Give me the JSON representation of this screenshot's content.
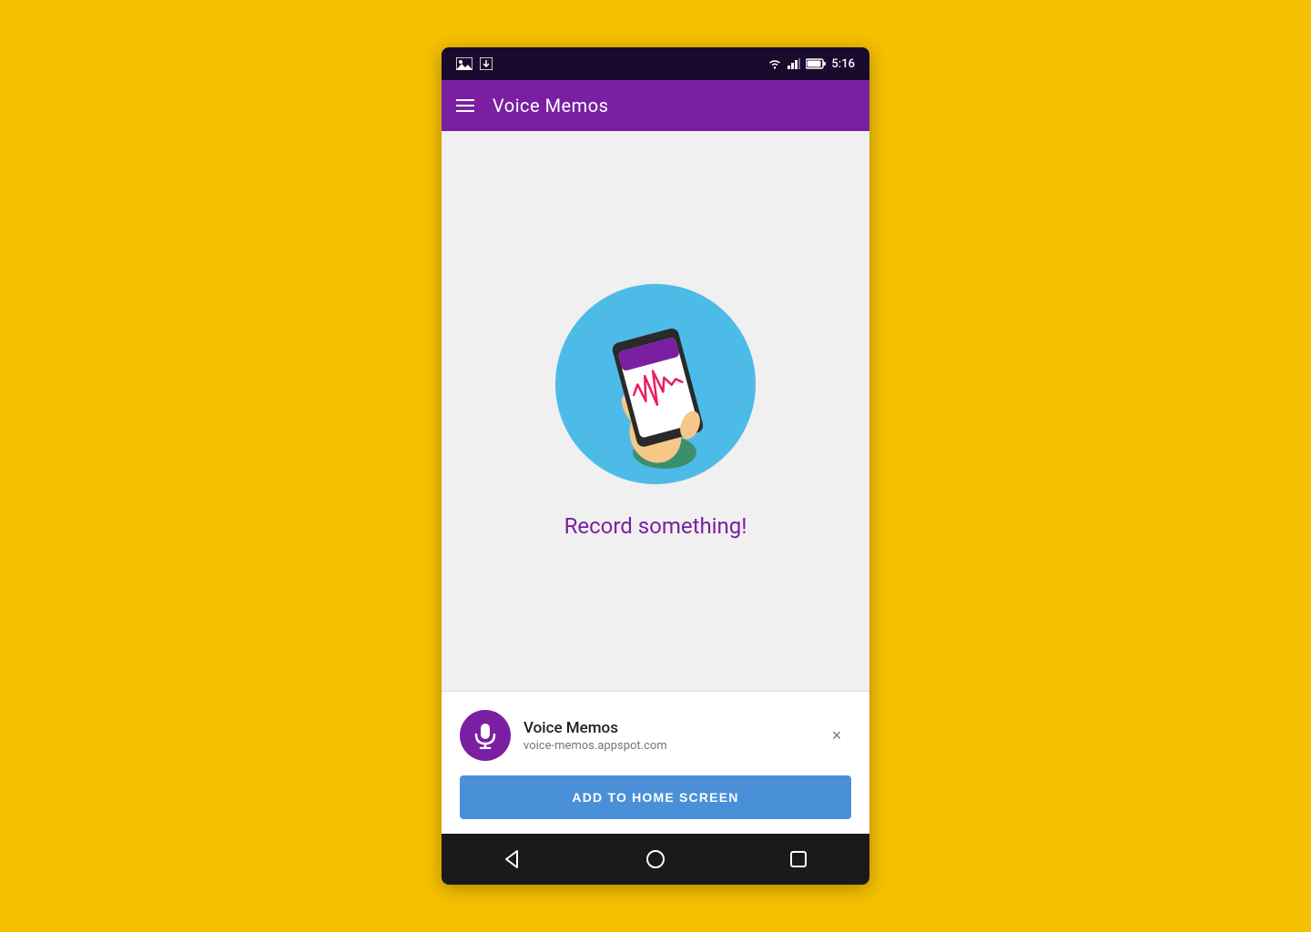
{
  "statusBar": {
    "time": "5:16",
    "icons": [
      "image-icon",
      "download-icon",
      "wifi-icon",
      "signal-icon",
      "battery-icon"
    ]
  },
  "appBar": {
    "title": "Voice Memos",
    "menuIcon": "hamburger-icon"
  },
  "mainContent": {
    "emptyStateText": "Record something!"
  },
  "bottomSheet": {
    "appName": "Voice Memos",
    "appUrl": "voice-memos.appspot.com",
    "addButtonLabel": "ADD TO HOME SCREEN",
    "closeIcon": "×"
  },
  "navBar": {
    "backIcon": "◁",
    "homeIcon": "○",
    "recentIcon": "□"
  }
}
